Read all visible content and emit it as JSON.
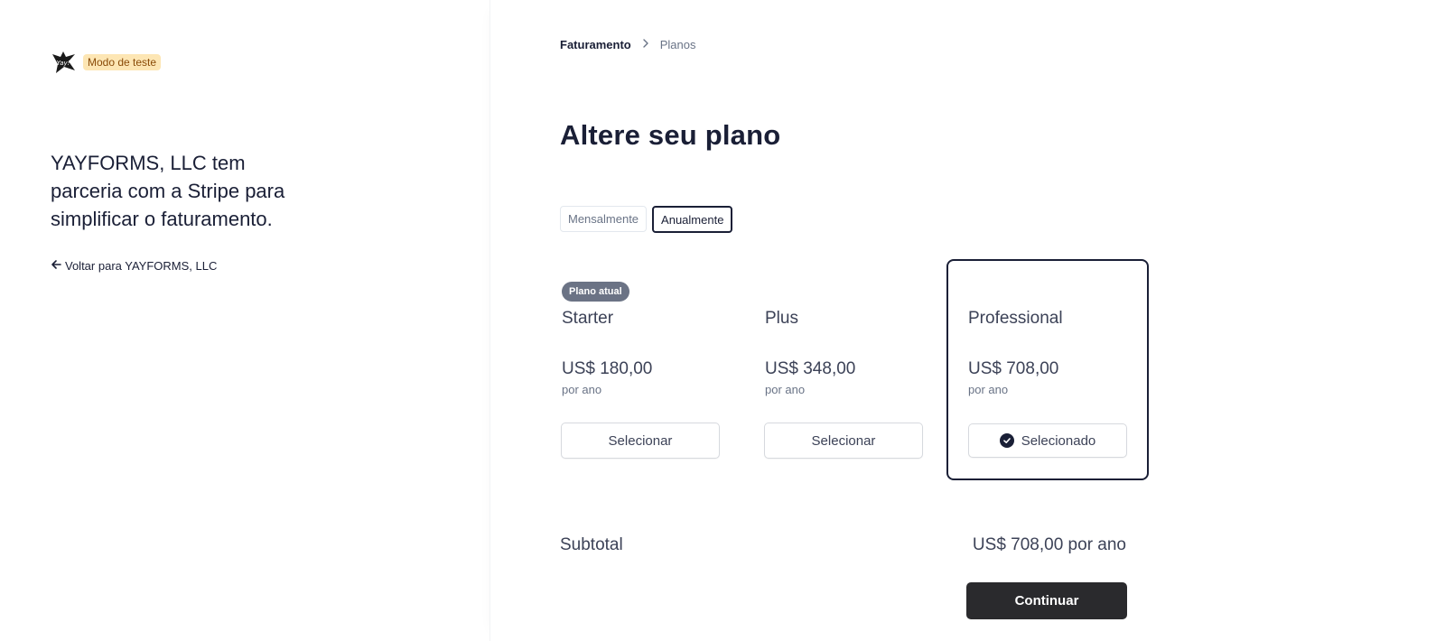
{
  "brand": {
    "logo_text": "Yay!",
    "test_mode_label": "Modo de teste"
  },
  "left": {
    "tagline": "YAYFORMS, LLC tem parceria com a Stripe para simplificar o faturamento.",
    "back_link": "Voltar para YAYFORMS, LLC"
  },
  "breadcrumb": {
    "items": [
      "Faturamento",
      "Planos"
    ]
  },
  "page_title": "Altere seu plano",
  "billing_toggle": {
    "options": [
      "Mensalmente",
      "Anualmente"
    ],
    "selected": "Anualmente"
  },
  "plans": [
    {
      "badge": "Plano atual",
      "name": "Starter",
      "price": "US$ 180,00",
      "period": "por ano",
      "button_label": "Selecionar",
      "selected": false
    },
    {
      "badge": "",
      "name": "Plus",
      "price": "US$ 348,00",
      "period": "por ano",
      "button_label": "Selecionar",
      "selected": false
    },
    {
      "badge": "",
      "name": "Professional",
      "price": "US$ 708,00",
      "period": "por ano",
      "button_label": "Selecionado",
      "selected": true
    }
  ],
  "summary": {
    "subtotal_label": "Subtotal",
    "subtotal_value": "US$ 708,00 por ano",
    "continue_label": "Continuar"
  },
  "colors": {
    "primary_text": "#1a1f36",
    "test_badge_bg": "#fde6b4",
    "continue_button_bg": "#2a2a2d",
    "current_badge_bg": "#6b7385"
  },
  "icons": {
    "logo": "yayforms-logo-icon",
    "back": "arrow-left-icon",
    "breadcrumb_separator": "chevron-right-icon",
    "selected": "check-circle-icon"
  }
}
